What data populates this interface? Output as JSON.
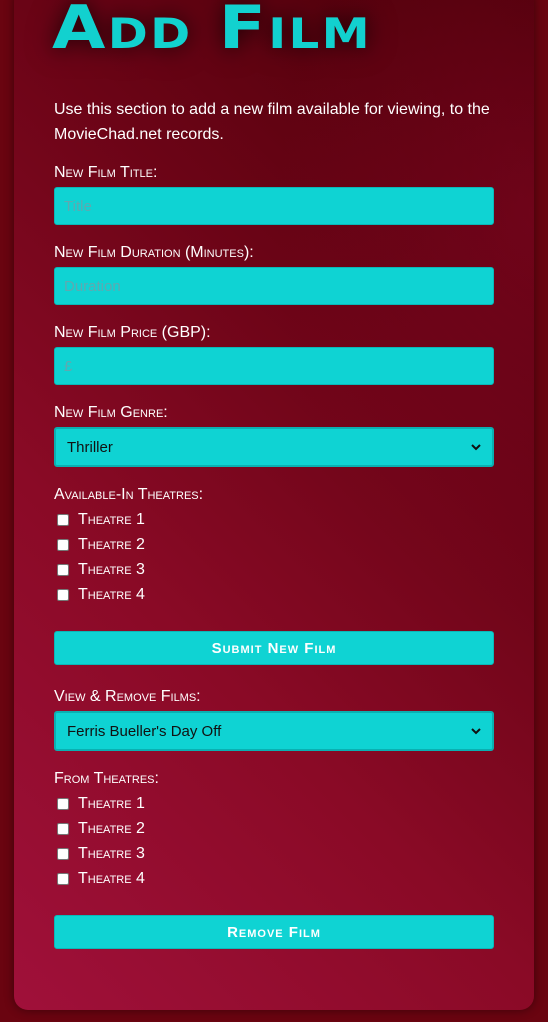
{
  "page": {
    "heading": "Add Film",
    "intro": "Use this section to add a new film available for viewing, to the MovieChad.net records."
  },
  "add_form": {
    "title_label": "New Film Title:",
    "title_placeholder": "Title",
    "title_value": "",
    "duration_label": "New Film Duration (Minutes):",
    "duration_placeholder": "Duration",
    "duration_value": "",
    "price_label": "New Film Price (GBP):",
    "price_placeholder": "£",
    "price_value": "",
    "genre_label": "New Film Genre:",
    "genre_selected": "Thriller",
    "theatres_label": "Available-In Theatres:",
    "theatres": [
      {
        "label": "Theatre 1",
        "checked": false
      },
      {
        "label": "Theatre 2",
        "checked": false
      },
      {
        "label": "Theatre 3",
        "checked": false
      },
      {
        "label": "Theatre 4",
        "checked": false
      }
    ],
    "submit_label": "Submit New Film"
  },
  "remove_form": {
    "films_label": "View & Remove Films:",
    "film_selected": "Ferris Bueller's Day Off",
    "theatres_label": "From Theatres:",
    "theatres": [
      {
        "label": "Theatre 1",
        "checked": false
      },
      {
        "label": "Theatre 2",
        "checked": false
      },
      {
        "label": "Theatre 3",
        "checked": false
      },
      {
        "label": "Theatre 4",
        "checked": false
      }
    ],
    "remove_label": "Remove Film"
  },
  "colors": {
    "accent": "#0fd3d3",
    "background": "#6a0410",
    "panel": "#8a0a26",
    "text": "#ffffff"
  },
  "icons": {
    "select_arrow": "chevron-down-icon"
  }
}
